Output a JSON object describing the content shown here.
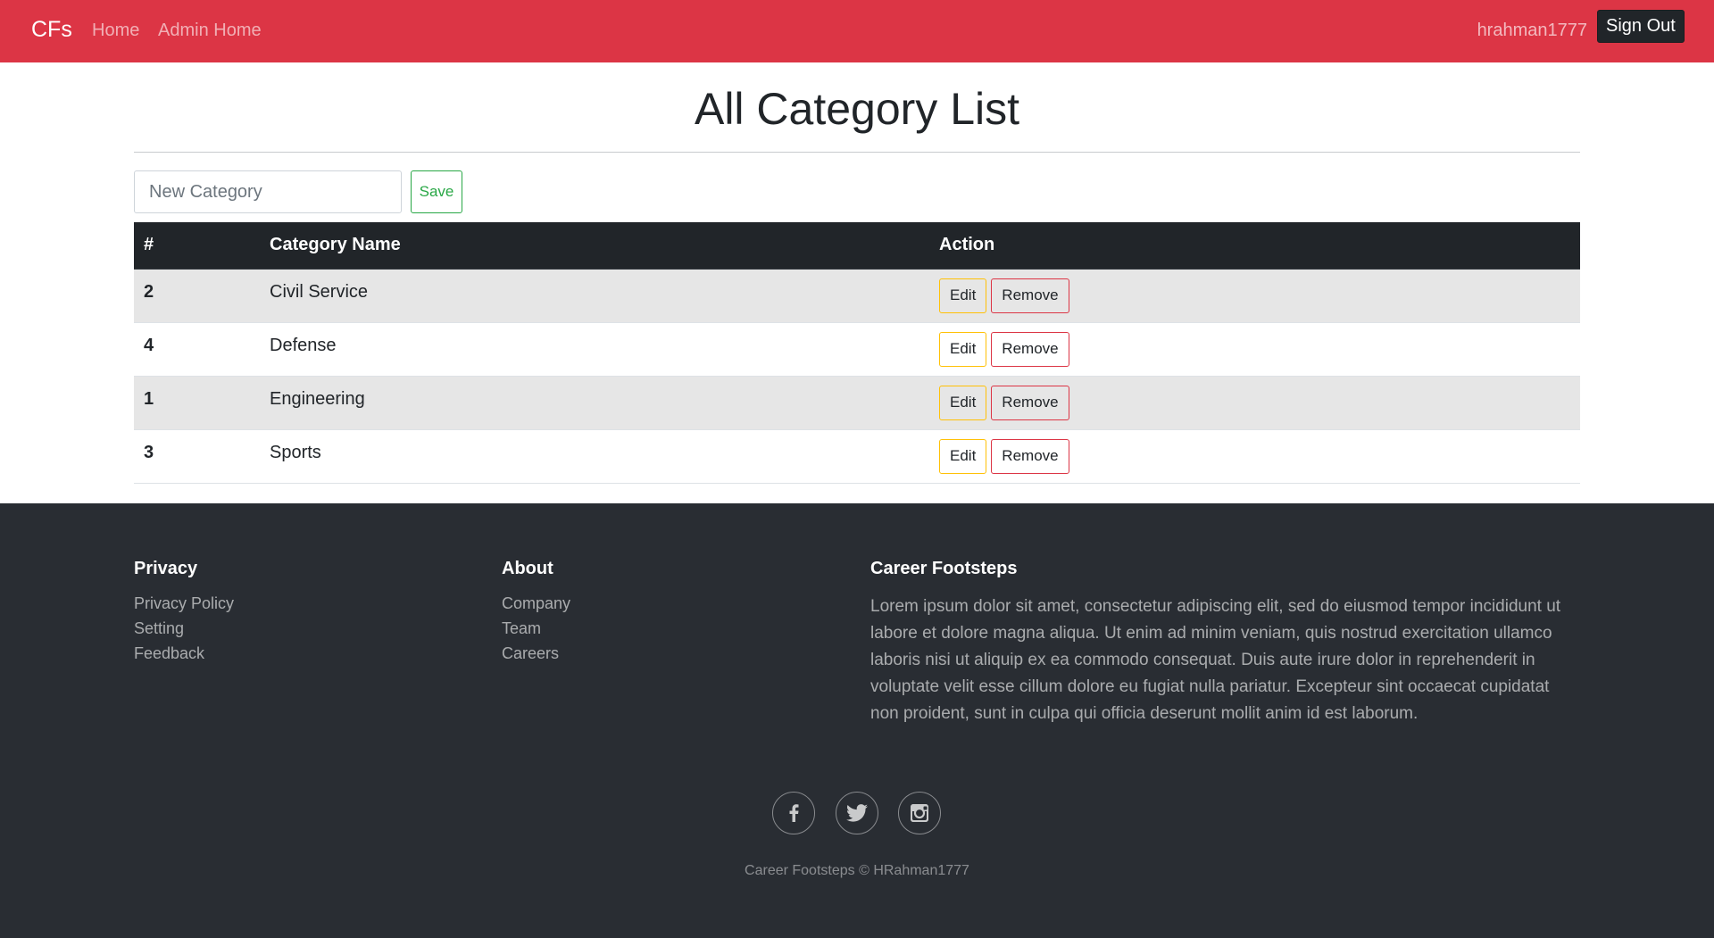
{
  "navbar": {
    "brand": "CFs",
    "links": [
      "Home",
      "Admin Home"
    ],
    "username": "hrahman1777",
    "signout_label": "Sign Out",
    "color": "#dc3545"
  },
  "main": {
    "title": "All Category List",
    "new_category_placeholder": "New Category",
    "new_category_value": "",
    "save_label": "Save",
    "table": {
      "columns": [
        "#",
        "Category Name",
        "Action"
      ],
      "rows": [
        {
          "id": "2",
          "name": "Civil Service"
        },
        {
          "id": "4",
          "name": "Defense"
        },
        {
          "id": "1",
          "name": "Engineering"
        },
        {
          "id": "3",
          "name": "Sports"
        }
      ],
      "edit_label": "Edit",
      "remove_label": "Remove"
    }
  },
  "footer": {
    "privacy": {
      "heading": "Privacy",
      "links": [
        "Privacy Policy",
        "Setting",
        "Feedback"
      ]
    },
    "about": {
      "heading": "About",
      "links": [
        "Company",
        "Team",
        "Careers"
      ]
    },
    "career": {
      "heading": "Career Footsteps",
      "text": "Lorem ipsum dolor sit amet, consectetur adipiscing elit, sed do eiusmod tempor incididunt ut labore et dolore magna aliqua. Ut enim ad minim veniam, quis nostrud exercitation ullamco laboris nisi ut aliquip ex ea commodo consequat. Duis aute irure dolor in reprehenderit in voluptate velit esse cillum dolore eu fugiat nulla pariatur. Excepteur sint occaecat cupidatat non proident, sunt in culpa qui officia deserunt mollit anim id est laborum."
    },
    "social_icons": [
      "facebook-icon",
      "twitter-icon",
      "instagram-icon"
    ],
    "copyright": "Career Footsteps © HRahman1777",
    "color": "#292d33"
  }
}
